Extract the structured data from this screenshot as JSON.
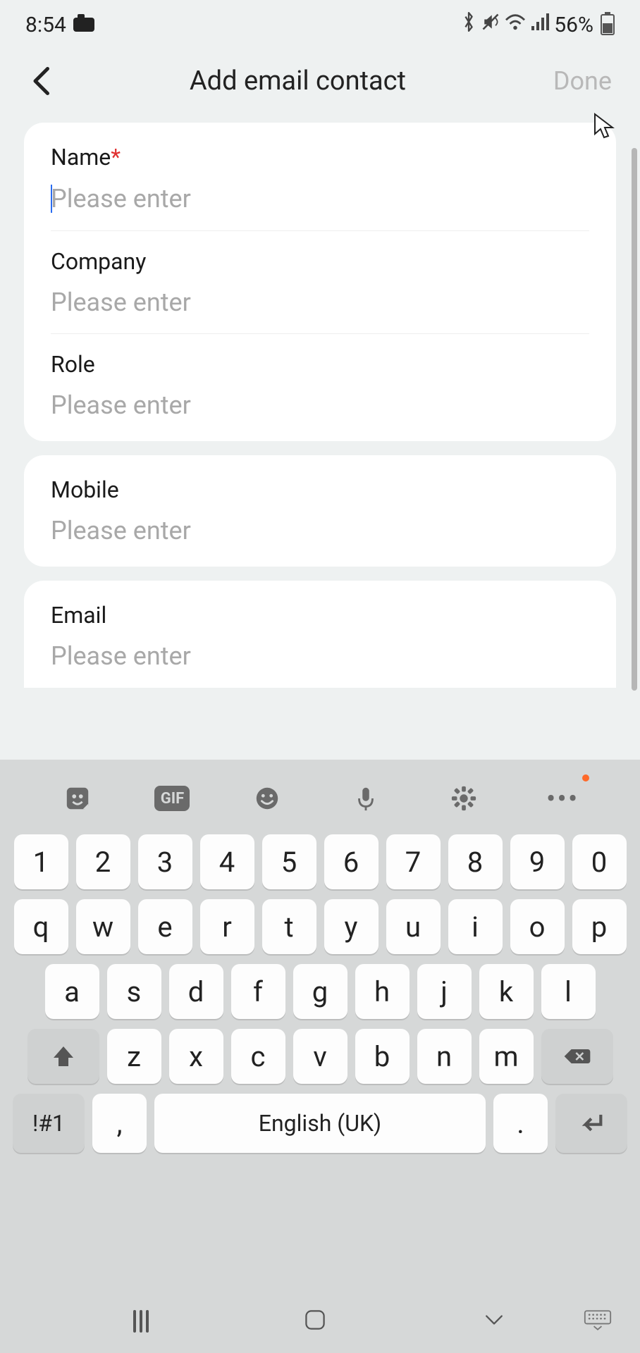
{
  "status": {
    "time": "8:54",
    "battery_pct": "56%"
  },
  "header": {
    "title": "Add email contact",
    "done": "Done"
  },
  "fields": {
    "name": {
      "label": "Name",
      "required": true,
      "placeholder": "Please enter",
      "value": ""
    },
    "company": {
      "label": "Company",
      "required": false,
      "placeholder": "Please enter",
      "value": ""
    },
    "role": {
      "label": "Role",
      "required": false,
      "placeholder": "Please enter",
      "value": ""
    },
    "mobile": {
      "label": "Mobile",
      "required": false,
      "placeholder": "Please enter",
      "value": ""
    },
    "email": {
      "label": "Email",
      "required": false,
      "placeholder": "Please enter",
      "value": ""
    }
  },
  "keyboard": {
    "toolbar_gif": "GIF",
    "row_num": [
      "1",
      "2",
      "3",
      "4",
      "5",
      "6",
      "7",
      "8",
      "9",
      "0"
    ],
    "row_q": [
      "q",
      "w",
      "e",
      "r",
      "t",
      "y",
      "u",
      "i",
      "o",
      "p"
    ],
    "row_a": [
      "a",
      "s",
      "d",
      "f",
      "g",
      "h",
      "j",
      "k",
      "l"
    ],
    "row_z": [
      "z",
      "x",
      "c",
      "v",
      "b",
      "n",
      "m"
    ],
    "sym": "!#1",
    "comma": ",",
    "space": "English (UK)",
    "period": "."
  }
}
